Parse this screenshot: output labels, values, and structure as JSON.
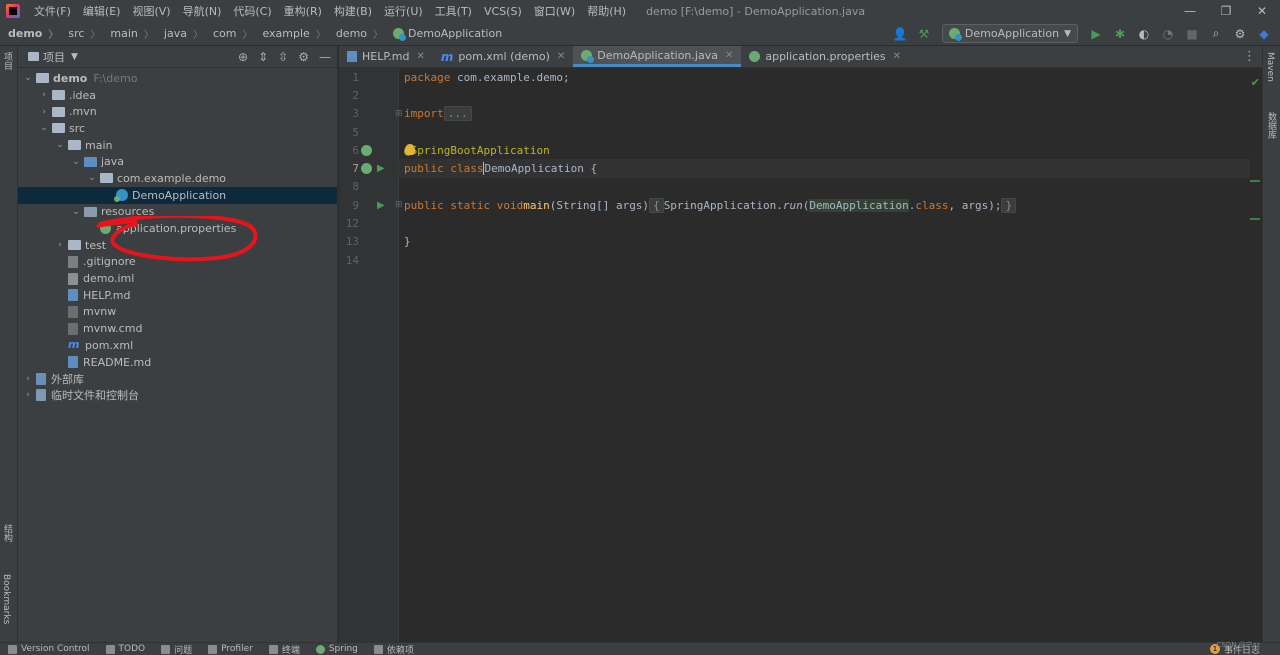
{
  "window": {
    "title": "demo [F:\\demo] - DemoApplication.java",
    "controls": [
      "—",
      "❐",
      "✕"
    ]
  },
  "menu": [
    "文件(F)",
    "编辑(E)",
    "视图(V)",
    "导航(N)",
    "代码(C)",
    "重构(R)",
    "构建(B)",
    "运行(U)",
    "工具(T)",
    "VCS(S)",
    "窗口(W)",
    "帮助(H)"
  ],
  "breadcrumb": [
    "demo",
    "src",
    "main",
    "java",
    "com",
    "example",
    "demo",
    "DemoApplication"
  ],
  "toolbar": {
    "run_config": "DemoApplication",
    "icons": [
      "user-icon",
      "build-hammer-icon",
      "run-icon",
      "debug-icon",
      "coverage-icon",
      "profile-icon",
      "stop-icon",
      "search-icon",
      "settings-icon",
      "jetbrains-logo"
    ]
  },
  "left_strip": {
    "project_label": "项目",
    "structure_label": "结构",
    "bookmarks_label": "Bookmarks"
  },
  "right_strip": {
    "maven_label": "Maven",
    "database_label": "数据库"
  },
  "project_panel": {
    "title": "项目",
    "tree": [
      {
        "label": "demo",
        "hint": "F:\\demo"
      },
      {
        "label": ".idea"
      },
      {
        "label": ".mvn"
      },
      {
        "label": "src"
      },
      {
        "label": "main"
      },
      {
        "label": "java"
      },
      {
        "label": "com.example.demo"
      },
      {
        "label": "DemoApplication",
        "selected": true
      },
      {
        "label": "resources"
      },
      {
        "label": "application.properties"
      },
      {
        "label": "test"
      },
      {
        "label": ".gitignore"
      },
      {
        "label": "demo.iml"
      },
      {
        "label": "HELP.md"
      },
      {
        "label": "mvnw"
      },
      {
        "label": "mvnw.cmd"
      },
      {
        "label": "pom.xml"
      },
      {
        "label": "README.md"
      },
      {
        "label": "外部库"
      },
      {
        "label": "临时文件和控制台"
      }
    ]
  },
  "editor": {
    "tabs": [
      {
        "label": "HELP.md",
        "active": false
      },
      {
        "label": "pom.xml (demo)",
        "active": false
      },
      {
        "label": "DemoApplication.java",
        "active": true
      },
      {
        "label": "application.properties",
        "active": false
      }
    ],
    "line_numbers": [
      "1",
      "2",
      "3",
      "5",
      "6",
      "7",
      "8",
      "9",
      "12",
      "13",
      "14"
    ],
    "code": {
      "l1_kw": "package",
      "l1_rest": " com.example.demo;",
      "l3_kw": "import",
      "l3_fold": "...",
      "l6_ann": "@SpringBootApplication",
      "l7_kw": "public class",
      "l7_cls": "DemoApplication",
      "l7_brace": " {",
      "l9_kw": "public static void",
      "l9_fn": "main",
      "l9_args": "(String[] args)",
      "l9_open": "{",
      "l9_call": "SpringApplication.",
      "l9_run": "run",
      "l9_cls": "DemoApplication",
      "l9_tail1": ".",
      "l9_class_kw": "class",
      "l9_tail2": ", args);",
      "l9_close": "}",
      "l13": "}"
    }
  },
  "statusbar": {
    "items": [
      "Version Control",
      "TODO",
      "问题",
      "Profiler",
      "终端",
      "Spring",
      "依赖项"
    ],
    "event_log": "事件日志",
    "event_count": "1",
    "watermark": "CSDN @宁zz"
  }
}
